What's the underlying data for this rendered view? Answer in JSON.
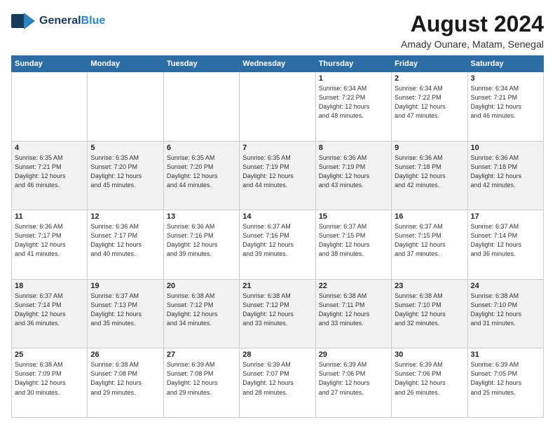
{
  "header": {
    "logo_general": "General",
    "logo_blue": "Blue",
    "month_title": "August 2024",
    "location": "Amady Ounare, Matam, Senegal"
  },
  "days_of_week": [
    "Sunday",
    "Monday",
    "Tuesday",
    "Wednesday",
    "Thursday",
    "Friday",
    "Saturday"
  ],
  "weeks": [
    [
      {
        "day": "",
        "info": ""
      },
      {
        "day": "",
        "info": ""
      },
      {
        "day": "",
        "info": ""
      },
      {
        "day": "",
        "info": ""
      },
      {
        "day": "1",
        "info": "Sunrise: 6:34 AM\nSunset: 7:22 PM\nDaylight: 12 hours\nand 48 minutes."
      },
      {
        "day": "2",
        "info": "Sunrise: 6:34 AM\nSunset: 7:22 PM\nDaylight: 12 hours\nand 47 minutes."
      },
      {
        "day": "3",
        "info": "Sunrise: 6:34 AM\nSunset: 7:21 PM\nDaylight: 12 hours\nand 46 minutes."
      }
    ],
    [
      {
        "day": "4",
        "info": "Sunrise: 6:35 AM\nSunset: 7:21 PM\nDaylight: 12 hours\nand 46 minutes."
      },
      {
        "day": "5",
        "info": "Sunrise: 6:35 AM\nSunset: 7:20 PM\nDaylight: 12 hours\nand 45 minutes."
      },
      {
        "day": "6",
        "info": "Sunrise: 6:35 AM\nSunset: 7:20 PM\nDaylight: 12 hours\nand 44 minutes."
      },
      {
        "day": "7",
        "info": "Sunrise: 6:35 AM\nSunset: 7:19 PM\nDaylight: 12 hours\nand 44 minutes."
      },
      {
        "day": "8",
        "info": "Sunrise: 6:36 AM\nSunset: 7:19 PM\nDaylight: 12 hours\nand 43 minutes."
      },
      {
        "day": "9",
        "info": "Sunrise: 6:36 AM\nSunset: 7:18 PM\nDaylight: 12 hours\nand 42 minutes."
      },
      {
        "day": "10",
        "info": "Sunrise: 6:36 AM\nSunset: 7:18 PM\nDaylight: 12 hours\nand 42 minutes."
      }
    ],
    [
      {
        "day": "11",
        "info": "Sunrise: 6:36 AM\nSunset: 7:17 PM\nDaylight: 12 hours\nand 41 minutes."
      },
      {
        "day": "12",
        "info": "Sunrise: 6:36 AM\nSunset: 7:17 PM\nDaylight: 12 hours\nand 40 minutes."
      },
      {
        "day": "13",
        "info": "Sunrise: 6:36 AM\nSunset: 7:16 PM\nDaylight: 12 hours\nand 39 minutes."
      },
      {
        "day": "14",
        "info": "Sunrise: 6:37 AM\nSunset: 7:16 PM\nDaylight: 12 hours\nand 39 minutes."
      },
      {
        "day": "15",
        "info": "Sunrise: 6:37 AM\nSunset: 7:15 PM\nDaylight: 12 hours\nand 38 minutes."
      },
      {
        "day": "16",
        "info": "Sunrise: 6:37 AM\nSunset: 7:15 PM\nDaylight: 12 hours\nand 37 minutes."
      },
      {
        "day": "17",
        "info": "Sunrise: 6:37 AM\nSunset: 7:14 PM\nDaylight: 12 hours\nand 36 minutes."
      }
    ],
    [
      {
        "day": "18",
        "info": "Sunrise: 6:37 AM\nSunset: 7:14 PM\nDaylight: 12 hours\nand 36 minutes."
      },
      {
        "day": "19",
        "info": "Sunrise: 6:37 AM\nSunset: 7:13 PM\nDaylight: 12 hours\nand 35 minutes."
      },
      {
        "day": "20",
        "info": "Sunrise: 6:38 AM\nSunset: 7:12 PM\nDaylight: 12 hours\nand 34 minutes."
      },
      {
        "day": "21",
        "info": "Sunrise: 6:38 AM\nSunset: 7:12 PM\nDaylight: 12 hours\nand 33 minutes."
      },
      {
        "day": "22",
        "info": "Sunrise: 6:38 AM\nSunset: 7:11 PM\nDaylight: 12 hours\nand 33 minutes."
      },
      {
        "day": "23",
        "info": "Sunrise: 6:38 AM\nSunset: 7:10 PM\nDaylight: 12 hours\nand 32 minutes."
      },
      {
        "day": "24",
        "info": "Sunrise: 6:38 AM\nSunset: 7:10 PM\nDaylight: 12 hours\nand 31 minutes."
      }
    ],
    [
      {
        "day": "25",
        "info": "Sunrise: 6:38 AM\nSunset: 7:09 PM\nDaylight: 12 hours\nand 30 minutes."
      },
      {
        "day": "26",
        "info": "Sunrise: 6:38 AM\nSunset: 7:08 PM\nDaylight: 12 hours\nand 29 minutes."
      },
      {
        "day": "27",
        "info": "Sunrise: 6:39 AM\nSunset: 7:08 PM\nDaylight: 12 hours\nand 29 minutes."
      },
      {
        "day": "28",
        "info": "Sunrise: 6:39 AM\nSunset: 7:07 PM\nDaylight: 12 hours\nand 28 minutes."
      },
      {
        "day": "29",
        "info": "Sunrise: 6:39 AM\nSunset: 7:06 PM\nDaylight: 12 hours\nand 27 minutes."
      },
      {
        "day": "30",
        "info": "Sunrise: 6:39 AM\nSunset: 7:06 PM\nDaylight: 12 hours\nand 26 minutes."
      },
      {
        "day": "31",
        "info": "Sunrise: 6:39 AM\nSunset: 7:05 PM\nDaylight: 12 hours\nand 25 minutes."
      }
    ]
  ]
}
